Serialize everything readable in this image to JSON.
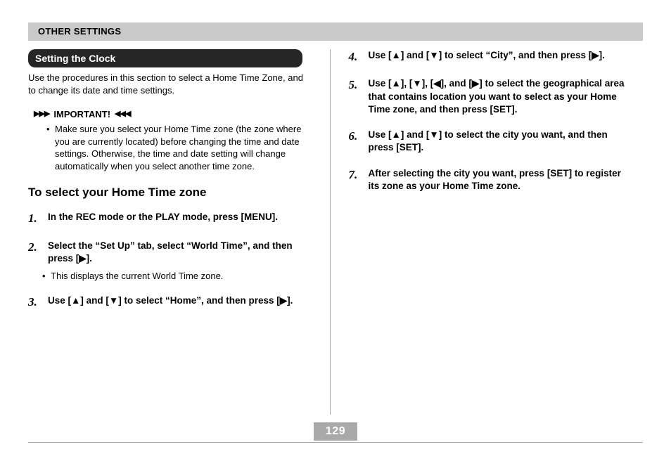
{
  "header": "OTHER SETTINGS",
  "section_title": "Setting the Clock",
  "intro": "Use the procedures in this section to select a Home Time Zone, and to change its date and time settings.",
  "important_label": "IMPORTANT!",
  "important_deco_left": "▶▶▶",
  "important_deco_right": "◀◀◀",
  "important_text": "Make sure you select your Home Time zone (the zone where you are currently located) before changing the time and date settings. Otherwise, the time and date setting will change automatically when you select another time zone.",
  "subhead": "To select your Home Time zone",
  "steps_left": [
    {
      "n": "1.",
      "t": "In the REC mode or the PLAY mode, press [MENU]."
    },
    {
      "n": "2.",
      "t": "Select the “Set Up” tab, select “World Time”, and then press [▶]."
    },
    {
      "n": "3.",
      "t": "Use [▲] and [▼] to select “Home”, and then press [▶]."
    }
  ],
  "step2_sub": "This displays the current World Time zone.",
  "steps_right": [
    {
      "n": "4.",
      "t": "Use [▲] and [▼] to select “City”, and then press [▶]."
    },
    {
      "n": "5.",
      "t": "Use [▲], [▼], [◀], and [▶] to select the geographical area that contains location you want to select as your Home Time zone, and then press [SET]."
    },
    {
      "n": "6.",
      "t": "Use [▲] and [▼] to select the city you want, and then press [SET]."
    },
    {
      "n": "7.",
      "t": "After selecting the city you want, press [SET] to register its zone as your Home Time zone."
    }
  ],
  "page_number": "129"
}
